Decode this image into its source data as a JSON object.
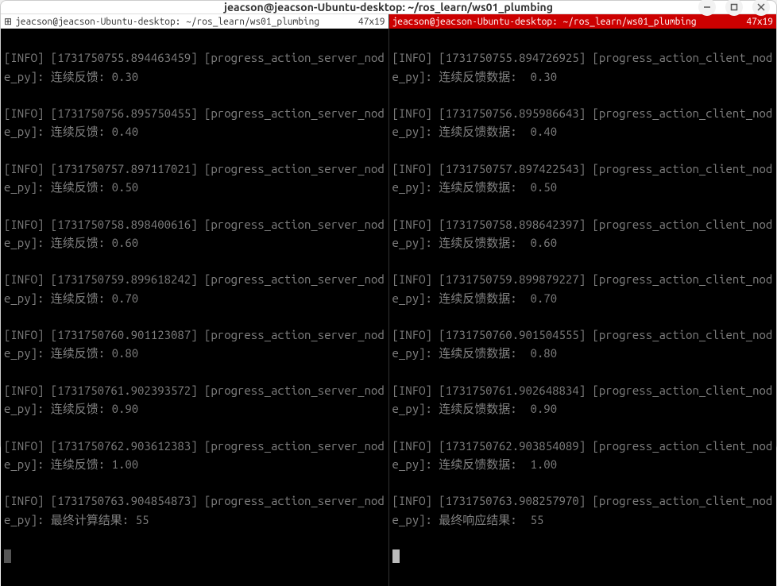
{
  "window": {
    "title": "jeacson@jeacson-Ubuntu-desktop: ~/ros_learn/ws01_plumbing"
  },
  "panes": {
    "left": {
      "header": {
        "icon": "⊞",
        "path": "jeacson@jeacson-Ubuntu-desktop: ~/ros_learn/ws01_plumbing",
        "dims": "47x19"
      },
      "lines": [
        "[INFO] [1731750755.894463459] [progress_action_server_node_py]: 连续反馈: 0.30",
        "[INFO] [1731750756.895750455] [progress_action_server_node_py]: 连续反馈: 0.40",
        "[INFO] [1731750757.897117021] [progress_action_server_node_py]: 连续反馈: 0.50",
        "[INFO] [1731750758.898400616] [progress_action_server_node_py]: 连续反馈: 0.60",
        "[INFO] [1731750759.899618242] [progress_action_server_node_py]: 连续反馈: 0.70",
        "[INFO] [1731750760.901123087] [progress_action_server_node_py]: 连续反馈: 0.80",
        "[INFO] [1731750761.902393572] [progress_action_server_node_py]: 连续反馈: 0.90",
        "[INFO] [1731750762.903612383] [progress_action_server_node_py]: 连续反馈: 1.00",
        "[INFO] [1731750763.904854873] [progress_action_server_node_py]: 最终计算结果: 55"
      ]
    },
    "right": {
      "header": {
        "icon": "",
        "path": "jeacson@jeacson-Ubuntu-desktop: ~/ros_learn/ws01_plumbing",
        "dims": "47x19"
      },
      "lines": [
        "[INFO] [1731750755.894726925] [progress_action_client_node_py]: 连续反馈数据:  0.30",
        "[INFO] [1731750756.895986643] [progress_action_client_node_py]: 连续反馈数据:  0.40",
        "[INFO] [1731750757.897422543] [progress_action_client_node_py]: 连续反馈数据:  0.50",
        "[INFO] [1731750758.898642397] [progress_action_client_node_py]: 连续反馈数据:  0.60",
        "[INFO] [1731750759.899879227] [progress_action_client_node_py]: 连续反馈数据:  0.70",
        "[INFO] [1731750760.901504555] [progress_action_client_node_py]: 连续反馈数据:  0.80",
        "[INFO] [1731750761.902648834] [progress_action_client_node_py]: 连续反馈数据:  0.90",
        "[INFO] [1731750762.903854089] [progress_action_client_node_py]: 连续反馈数据:  1.00",
        "[INFO] [1731750763.908257970] [progress_action_client_node_py]: 最终响应结果:  55"
      ]
    }
  }
}
